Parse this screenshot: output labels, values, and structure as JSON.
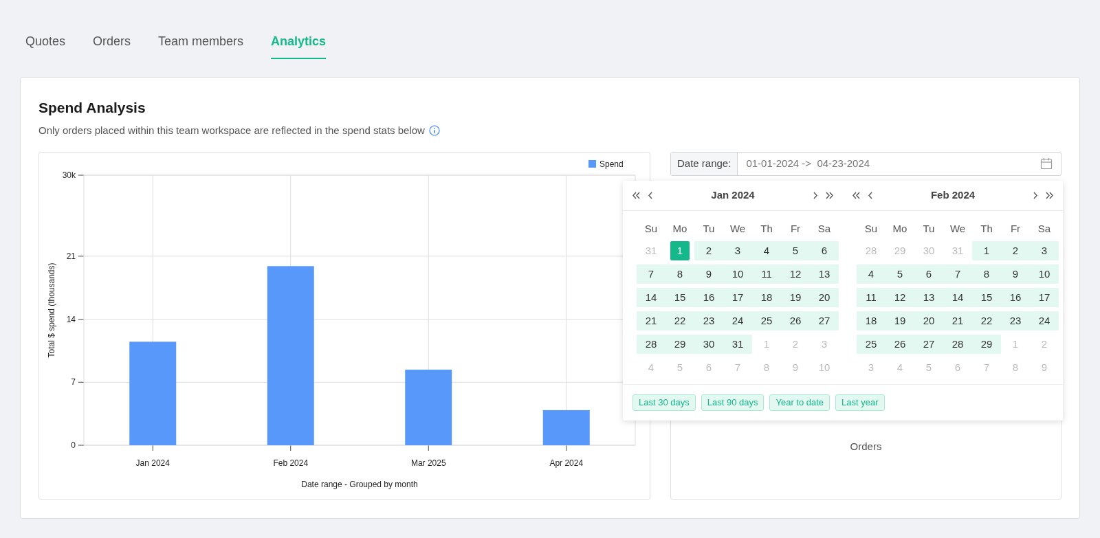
{
  "tabs": [
    {
      "label": "Quotes",
      "selected": false
    },
    {
      "label": "Orders",
      "selected": false
    },
    {
      "label": "Team members",
      "selected": false
    },
    {
      "label": "Analytics",
      "selected": true
    }
  ],
  "panel": {
    "title": "Spend Analysis",
    "note": "Only orders placed within this team workspace are reflected in the spend stats below"
  },
  "chart_data": {
    "type": "bar",
    "xlabel": "Date range - Grouped by month",
    "ylabel": "Total $ spend (thousands)",
    "categories": [
      "Jan 2024",
      "Feb 2024",
      "Mar 2025",
      "Apr 2024"
    ],
    "series": [
      {
        "name": "Spend",
        "color": "#5898fb",
        "values": [
          11.5,
          19.9,
          8.4,
          3.9
        ]
      }
    ],
    "ylim": [
      0,
      30
    ],
    "yticks": [
      0,
      7,
      14,
      21,
      {
        "value": 30,
        "label": "30k"
      }
    ],
    "grid": true
  },
  "date_range": {
    "label": "Date range:",
    "value": "01-01-2024 ->  04-23-2024"
  },
  "calendar": {
    "months": [
      {
        "title": "Jan 2024",
        "weekdays": [
          "Su",
          "Mo",
          "Tu",
          "We",
          "Th",
          "Fr",
          "Sa"
        ],
        "weeks": [
          [
            {
              "day": "31",
              "kind": "outside"
            },
            {
              "day": "1",
              "kind": "start"
            },
            {
              "day": "2",
              "kind": "range"
            },
            {
              "day": "3",
              "kind": "range"
            },
            {
              "day": "4",
              "kind": "range"
            },
            {
              "day": "5",
              "kind": "range"
            },
            {
              "day": "6",
              "kind": "range"
            }
          ],
          [
            {
              "day": "7",
              "kind": "range"
            },
            {
              "day": "8",
              "kind": "range"
            },
            {
              "day": "9",
              "kind": "range"
            },
            {
              "day": "10",
              "kind": "range"
            },
            {
              "day": "11",
              "kind": "range"
            },
            {
              "day": "12",
              "kind": "range"
            },
            {
              "day": "13",
              "kind": "range"
            }
          ],
          [
            {
              "day": "14",
              "kind": "range"
            },
            {
              "day": "15",
              "kind": "range"
            },
            {
              "day": "16",
              "kind": "range"
            },
            {
              "day": "17",
              "kind": "range"
            },
            {
              "day": "18",
              "kind": "range"
            },
            {
              "day": "19",
              "kind": "range"
            },
            {
              "day": "20",
              "kind": "range"
            }
          ],
          [
            {
              "day": "21",
              "kind": "range"
            },
            {
              "day": "22",
              "kind": "range"
            },
            {
              "day": "23",
              "kind": "range"
            },
            {
              "day": "24",
              "kind": "range"
            },
            {
              "day": "25",
              "kind": "range"
            },
            {
              "day": "26",
              "kind": "range"
            },
            {
              "day": "27",
              "kind": "range"
            }
          ],
          [
            {
              "day": "28",
              "kind": "range"
            },
            {
              "day": "29",
              "kind": "range"
            },
            {
              "day": "30",
              "kind": "range"
            },
            {
              "day": "31",
              "kind": "range"
            },
            {
              "day": "1",
              "kind": "outside"
            },
            {
              "day": "2",
              "kind": "outside"
            },
            {
              "day": "3",
              "kind": "outside"
            }
          ],
          [
            {
              "day": "4",
              "kind": "outside"
            },
            {
              "day": "5",
              "kind": "outside"
            },
            {
              "day": "6",
              "kind": "outside"
            },
            {
              "day": "7",
              "kind": "outside"
            },
            {
              "day": "8",
              "kind": "outside"
            },
            {
              "day": "9",
              "kind": "outside"
            },
            {
              "day": "10",
              "kind": "outside"
            }
          ]
        ]
      },
      {
        "title": "Feb 2024",
        "weekdays": [
          "Su",
          "Mo",
          "Tu",
          "We",
          "Th",
          "Fr",
          "Sa"
        ],
        "weeks": [
          [
            {
              "day": "28",
              "kind": "outside"
            },
            {
              "day": "29",
              "kind": "outside"
            },
            {
              "day": "30",
              "kind": "outside"
            },
            {
              "day": "31",
              "kind": "outside"
            },
            {
              "day": "1",
              "kind": "range"
            },
            {
              "day": "2",
              "kind": "range"
            },
            {
              "day": "3",
              "kind": "range"
            }
          ],
          [
            {
              "day": "4",
              "kind": "range"
            },
            {
              "day": "5",
              "kind": "range"
            },
            {
              "day": "6",
              "kind": "range"
            },
            {
              "day": "7",
              "kind": "range"
            },
            {
              "day": "8",
              "kind": "range"
            },
            {
              "day": "9",
              "kind": "range"
            },
            {
              "day": "10",
              "kind": "range"
            }
          ],
          [
            {
              "day": "11",
              "kind": "range"
            },
            {
              "day": "12",
              "kind": "range"
            },
            {
              "day": "13",
              "kind": "range"
            },
            {
              "day": "14",
              "kind": "range"
            },
            {
              "day": "15",
              "kind": "range"
            },
            {
              "day": "16",
              "kind": "range"
            },
            {
              "day": "17",
              "kind": "range"
            }
          ],
          [
            {
              "day": "18",
              "kind": "range"
            },
            {
              "day": "19",
              "kind": "range"
            },
            {
              "day": "20",
              "kind": "range"
            },
            {
              "day": "21",
              "kind": "range"
            },
            {
              "day": "22",
              "kind": "range"
            },
            {
              "day": "23",
              "kind": "range"
            },
            {
              "day": "24",
              "kind": "range"
            }
          ],
          [
            {
              "day": "25",
              "kind": "range"
            },
            {
              "day": "26",
              "kind": "range"
            },
            {
              "day": "27",
              "kind": "range"
            },
            {
              "day": "28",
              "kind": "range"
            },
            {
              "day": "29",
              "kind": "range"
            },
            {
              "day": "1",
              "kind": "outside"
            },
            {
              "day": "2",
              "kind": "outside"
            }
          ],
          [
            {
              "day": "3",
              "kind": "outside"
            },
            {
              "day": "4",
              "kind": "outside"
            },
            {
              "day": "5",
              "kind": "outside"
            },
            {
              "day": "6",
              "kind": "outside"
            },
            {
              "day": "7",
              "kind": "outside"
            },
            {
              "day": "8",
              "kind": "outside"
            },
            {
              "day": "9",
              "kind": "outside"
            }
          ]
        ]
      }
    ],
    "presets": [
      "Last 30 days",
      "Last 90 days",
      "Year to date",
      "Last year"
    ]
  },
  "orders_card": {
    "title": "Orders"
  }
}
